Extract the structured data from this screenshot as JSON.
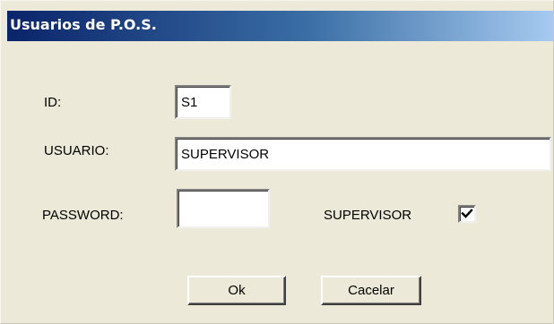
{
  "window": {
    "title": "Usuarios de P.O.S."
  },
  "form": {
    "id_label": "ID:",
    "id_value": "S1",
    "usuario_label": "USUARIO:",
    "usuario_value": "SUPERVISOR",
    "password_label": "PASSWORD:",
    "password_value": "",
    "supervisor_label": "SUPERVISOR",
    "supervisor_checked": true
  },
  "buttons": {
    "ok_label": "Ok",
    "cancel_label": "Cacelar"
  },
  "colors": {
    "title_gradient_start": "#0a246a",
    "title_gradient_end": "#a6caf0",
    "dialog_background": "#ece9d8"
  }
}
